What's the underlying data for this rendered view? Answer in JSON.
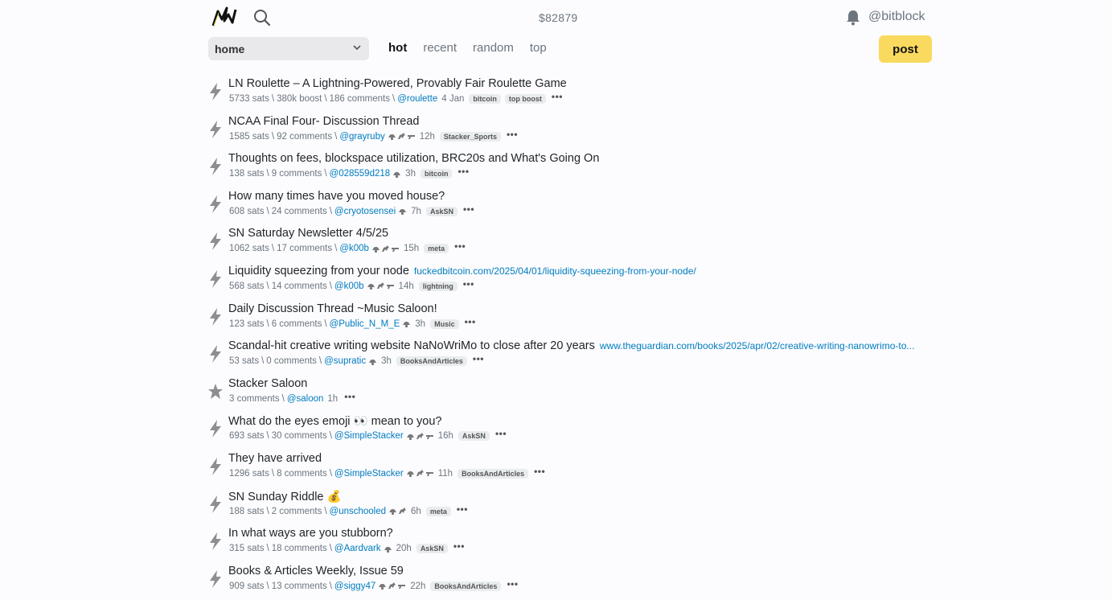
{
  "header": {
    "balance": "$82879",
    "username": "@bitblock"
  },
  "nav": {
    "sub": "home",
    "tabs": [
      "hot",
      "recent",
      "random",
      "top"
    ],
    "active_tab": "hot",
    "post_label": "post"
  },
  "colors": {
    "accent": "#fada5e",
    "link": "#007cbe"
  },
  "items": [
    {
      "title": "LN Roulette – A Lightning-Powered, Provably Fair Roulette Game",
      "link": "",
      "sats": "5733 sats",
      "boost": "380k boost",
      "comments": "186 comments",
      "user": "@roulette",
      "badges": 0,
      "age": "4 Jan",
      "tags": [
        "bitcoin",
        "top boost"
      ]
    },
    {
      "title": "NCAA Final Four- Discussion Thread",
      "link": "",
      "sats": "1585 sats",
      "boost": "",
      "comments": "92 comments",
      "user": "@grayruby",
      "badges": 3,
      "age": "12h",
      "tags": [
        "Stacker_Sports"
      ]
    },
    {
      "title": "Thoughts on fees, blockspace utilization, BRC20s and What's Going On",
      "link": "",
      "sats": "138 sats",
      "boost": "",
      "comments": "9 comments",
      "user": "@028559d218",
      "badges": 1,
      "age": "3h",
      "tags": [
        "bitcoin"
      ]
    },
    {
      "title": "How many times have you moved house?",
      "link": "",
      "sats": "608 sats",
      "boost": "",
      "comments": "24 comments",
      "user": "@cryotosensei",
      "badges": 1,
      "age": "7h",
      "tags": [
        "AskSN"
      ]
    },
    {
      "title": "SN Saturday Newsletter 4/5/25",
      "link": "",
      "sats": "1062 sats",
      "boost": "",
      "comments": "17 comments",
      "user": "@k00b",
      "badges": 3,
      "age": "15h",
      "tags": [
        "meta"
      ]
    },
    {
      "title": "Liquidity squeezing from your node",
      "link": "fuckedbitcoin.com/2025/04/01/liquidity-squeezing-from-your-node/",
      "sats": "568 sats",
      "boost": "",
      "comments": "14 comments",
      "user": "@k00b",
      "badges": 3,
      "age": "14h",
      "tags": [
        "lightning"
      ]
    },
    {
      "title": "Daily Discussion Thread ~Music Saloon!",
      "link": "",
      "sats": "123 sats",
      "boost": "",
      "comments": "6 comments",
      "user": "@Public_N_M_E",
      "badges": 1,
      "age": "3h",
      "tags": [
        "Music"
      ]
    },
    {
      "title": "Scandal-hit creative writing website NaNoWriMo to close after 20 years",
      "link": "www.theguardian.com/books/2025/apr/02/creative-writing-nanowrimo-to...",
      "sats": "53 sats",
      "boost": "",
      "comments": "0 comments",
      "user": "@supratic",
      "badges": 1,
      "age": "3h",
      "tags": [
        "BooksAndArticles"
      ]
    },
    {
      "title": "Stacker Saloon",
      "link": "",
      "sats": "",
      "boost": "",
      "comments": "3 comments",
      "user": "@saloon",
      "badges": 0,
      "age": "1h",
      "tags": [],
      "pinned": true
    },
    {
      "title": "What do the eyes emoji 👀 mean to you?",
      "link": "",
      "sats": "693 sats",
      "boost": "",
      "comments": "30 comments",
      "user": "@SimpleStacker",
      "badges": 3,
      "age": "16h",
      "tags": [
        "AskSN"
      ]
    },
    {
      "title": "They have arrived",
      "link": "",
      "sats": "1296 sats",
      "boost": "",
      "comments": "8 comments",
      "user": "@SimpleStacker",
      "badges": 3,
      "age": "11h",
      "tags": [
        "BooksAndArticles"
      ]
    },
    {
      "title": "SN Sunday Riddle 💰",
      "link": "",
      "sats": "188 sats",
      "boost": "",
      "comments": "2 comments",
      "user": "@unschooled",
      "badges": 2,
      "age": "6h",
      "tags": [
        "meta"
      ]
    },
    {
      "title": "In what ways are you stubborn?",
      "link": "",
      "sats": "315 sats",
      "boost": "",
      "comments": "18 comments",
      "user": "@Aardvark",
      "badges": 1,
      "age": "20h",
      "tags": [
        "AskSN"
      ]
    },
    {
      "title": "Books & Articles Weekly, Issue 59",
      "link": "",
      "sats": "909 sats",
      "boost": "",
      "comments": "13 comments",
      "user": "@siggy47",
      "badges": 3,
      "age": "22h",
      "tags": [
        "BooksAndArticles"
      ]
    }
  ]
}
